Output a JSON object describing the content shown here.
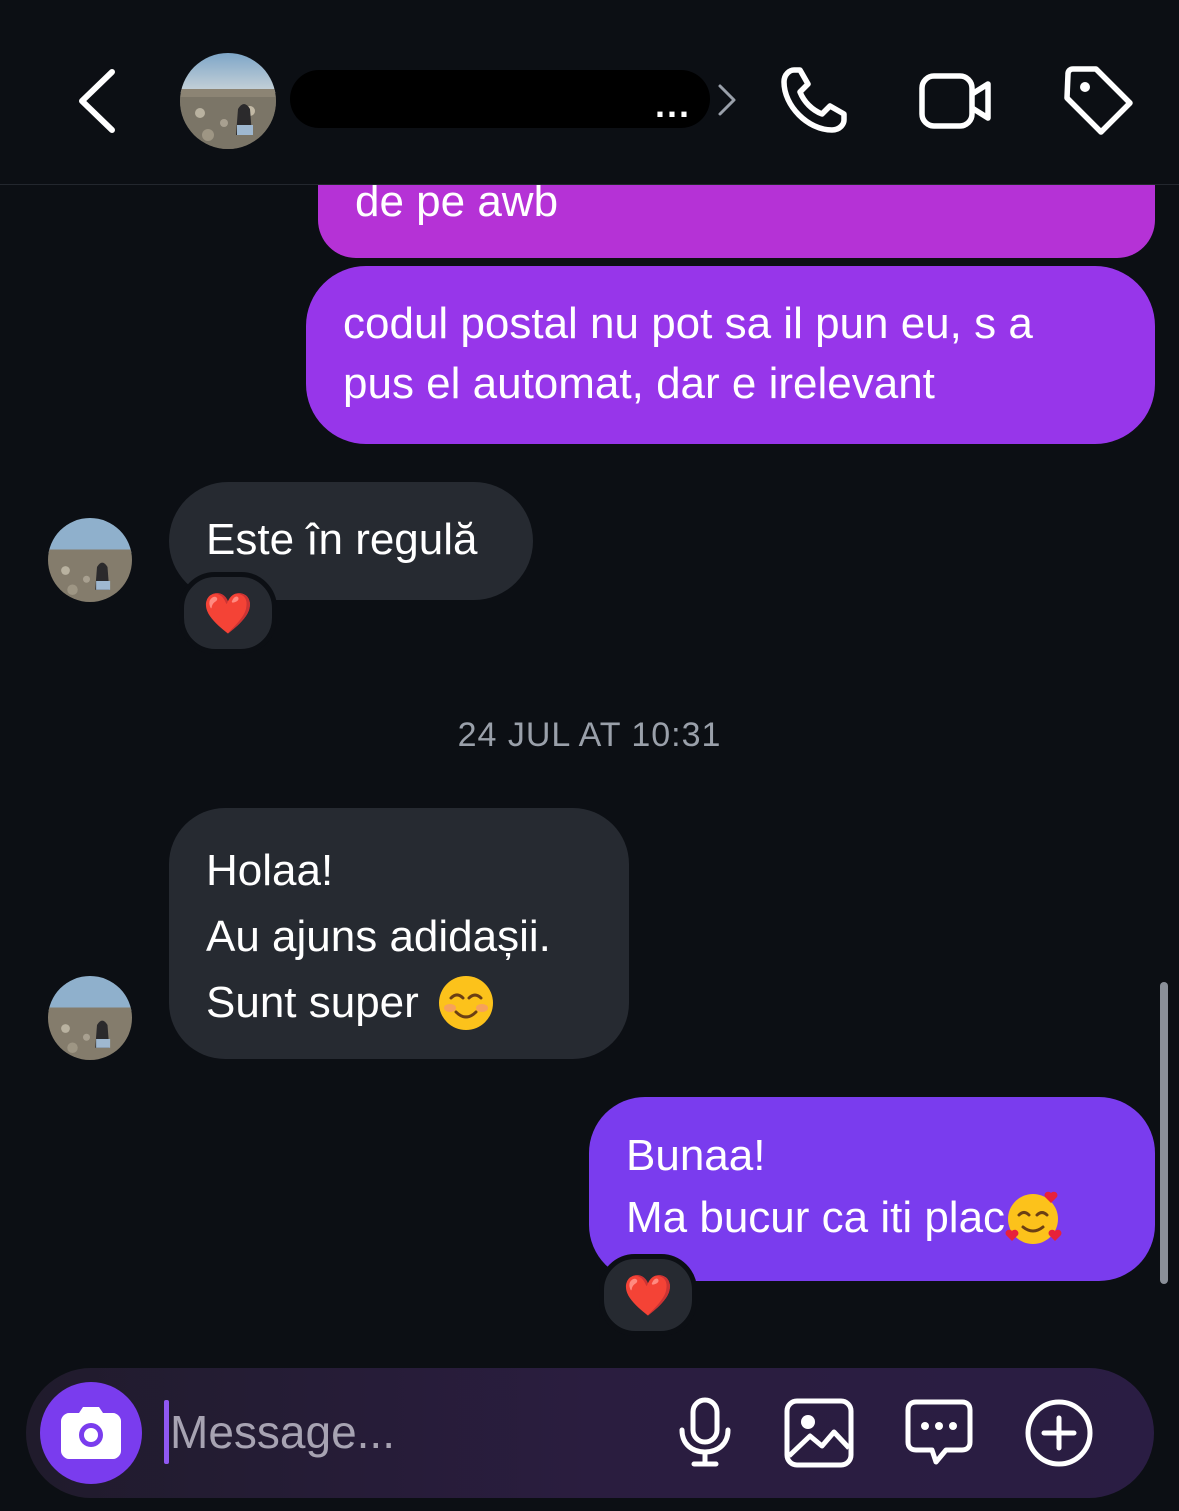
{
  "header": {
    "contact_name": "redacted",
    "name_ellipsis": "...",
    "actions": [
      "phone-icon",
      "video-icon",
      "tag-icon"
    ]
  },
  "messages": [
    {
      "id": "m1",
      "from": "me",
      "lines": [
        "de pe awb"
      ]
    },
    {
      "id": "m2",
      "from": "me",
      "lines": [
        "codul postal nu pot sa il pun eu, s a",
        "pus el automat, dar e irelevant"
      ]
    },
    {
      "id": "m3",
      "from": "them",
      "lines": [
        "Este în regulă"
      ],
      "reaction": "❤️"
    },
    {
      "id": "m4",
      "from": "them",
      "lines": [
        "Holaa!",
        "Au ajuns adidașii.",
        "Sunt super"
      ],
      "emoji": "smiling-face-emoji"
    },
    {
      "id": "m5",
      "from": "me",
      "lines": [
        "Bunaa!",
        "Ma bucur ca iti plac"
      ],
      "emoji": "smiling-face-with-hearts-emoji",
      "reaction": "❤️"
    }
  ],
  "timestamp": "24 JUL AT 10:31",
  "composer": {
    "placeholder": "Message...",
    "value": ""
  },
  "colors": {
    "background": "#0c0f14",
    "incoming_bubble": "#262a31",
    "outgoing_pink": "#b532d6",
    "outgoing_violet": "#9736ea",
    "outgoing_blue": "#7a3cee",
    "accent": "#7a3cee"
  }
}
